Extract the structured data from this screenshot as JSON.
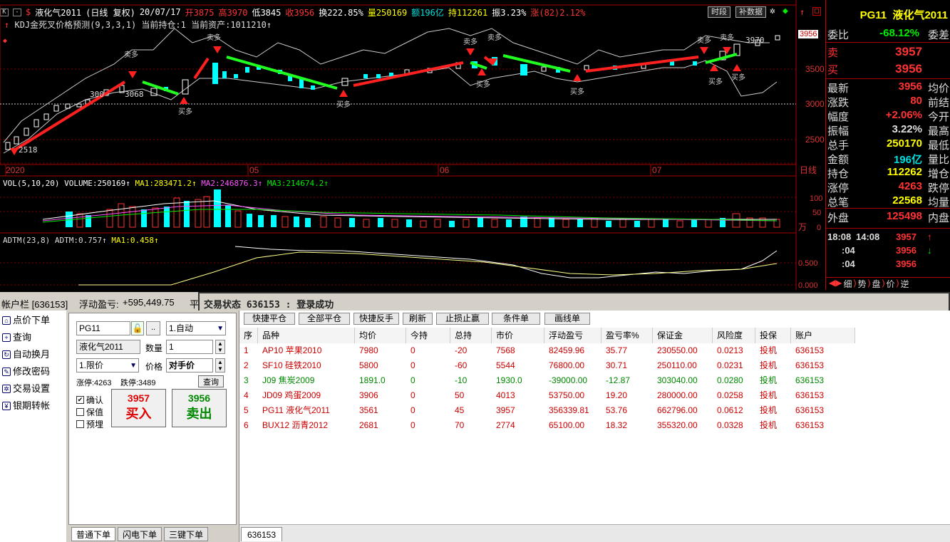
{
  "infobar": {
    "name": "液化气2011",
    "period": "(日线 复权)",
    "date": "20/07/17",
    "open": "开3875",
    "high": "高3970",
    "low": "低3845",
    "close": "收3956",
    "turnover": "换222.85%",
    "volume": "量250169",
    "amount": "额196亿",
    "hold": "持112261",
    "amplitude": "振3.23%",
    "change": "涨(82)2.12%",
    "btn_time": "时段",
    "btn_fill": "补数据"
  },
  "kdj_label": "KDJ金死叉价格预测(9,3,3,1)",
  "kdj_hold": "当前持仓:1",
  "kdj_assets": "当前资产:1011210",
  "price_labels": {
    "p3056": "3068",
    "p3000": "300",
    "p2518": "2518",
    "p3970": "3970",
    "mark": "3956"
  },
  "y_axis": [
    "3500",
    "3000",
    "2500"
  ],
  "x_axis": [
    "2020",
    "05",
    "06",
    "07",
    "日线"
  ],
  "vol_label": "VOL(5,10,20)",
  "vol_val": "VOLUME:250169",
  "vol_ma1": "MA1:283471.2",
  "vol_ma2": "MA2:246876.3",
  "vol_ma3": "MA3:214674.2",
  "vol_axis": [
    "100",
    "50",
    "0"
  ],
  "vol_unit": "万",
  "adtm_label": "ADTM(23,8)",
  "adtm_val": "ADTM:0.757",
  "adtm_ma": "MA1:0.458",
  "adtm_axis": [
    "0.500",
    "0.000"
  ],
  "buy_sell_labels": {
    "sell": "卖多",
    "buy": "买多"
  },
  "quote": {
    "code": "PG11",
    "name": "液化气2011",
    "weibi_label": "委比",
    "weibi": "-68.12%",
    "weicha_label": "委差",
    "sell_label": "卖",
    "sell": "3957",
    "buy_label": "买",
    "buy": "3956",
    "rows": [
      {
        "l": "最新",
        "v": "3956",
        "r": "均价",
        "c": "#ff3333"
      },
      {
        "l": "涨跌",
        "v": "80",
        "r": "前结",
        "c": "#ff3333"
      },
      {
        "l": "幅度",
        "v": "+2.06%",
        "r": "今开",
        "c": "#ff3333"
      },
      {
        "l": "振幅",
        "v": "3.22%",
        "r": "最高",
        "c": "#dddddd"
      },
      {
        "l": "总手",
        "v": "250170",
        "r": "最低",
        "c": "#ffff00"
      },
      {
        "l": "金额",
        "v": "196亿",
        "r": "量比",
        "c": "#00e0e0"
      },
      {
        "l": "持仓",
        "v": "112262",
        "r": "增仓",
        "c": "#ffff00"
      },
      {
        "l": "涨停",
        "v": "4263",
        "r": "跌停",
        "c": "#ff3333"
      },
      {
        "l": "总笔",
        "v": "22568",
        "r": "均量",
        "c": "#ffff00"
      }
    ],
    "waipan_label": "外盘",
    "waipan": "125498",
    "neipan_label": "内盘",
    "ticks": [
      {
        "t": "18:08",
        "t2": "14:08",
        "p": "3957",
        "a": "↑"
      },
      {
        "t": ":04",
        "t2": "",
        "p": "3956",
        "a": "↓"
      },
      {
        "t": ":04",
        "t2": "",
        "p": "3956",
        "a": ""
      }
    ],
    "tabs": [
      "细",
      "势",
      "盘",
      "价",
      "逆"
    ]
  },
  "account_bar": {
    "label": "帐户栏 [636153]",
    "profit_label": "浮动盈亏:",
    "profit": "+595,449.75",
    "flat": "平"
  },
  "status": "交易状态 636153 : 登录成功",
  "nav": [
    {
      "label": "点价下单",
      "icon": "chart-icon"
    },
    {
      "label": "查询",
      "icon": "plus-icon"
    },
    {
      "label": "自动换月",
      "icon": "cycle-icon"
    },
    {
      "label": "修改密码",
      "icon": "edit-icon"
    },
    {
      "label": "交易设置",
      "icon": "gear-icon"
    },
    {
      "label": "银期转帐",
      "icon": "money-icon"
    }
  ],
  "order": {
    "code": "PG11",
    "mode": "1.自动",
    "name": "液化气2011",
    "qty_label": "数量",
    "qty": "1",
    "type": "1.限价",
    "price_label": "价格",
    "price": "对手价",
    "limit_up": "涨停:4263",
    "limit_down": "跌停:3489",
    "query": "查询",
    "confirm": "确认",
    "hedge": "保值",
    "preorder": "预埋",
    "buy_price": "3957",
    "buy_label": "买入",
    "sell_price": "3956",
    "sell_label": "卖出",
    "dots": ".."
  },
  "table_buttons": [
    "快捷平仓",
    "全部平仓",
    "快捷反手",
    "刷新",
    "止损止赢",
    "条件单",
    "画线单"
  ],
  "table_headers": [
    "序",
    "品种",
    "均价",
    "今持",
    "总持",
    "市价",
    "浮动盈亏",
    "盈亏率%",
    "保证金",
    "风险度",
    "投保",
    "账户"
  ],
  "table_rows": [
    {
      "c": "red",
      "cells": [
        "1",
        "AP10 苹果2010",
        "7980",
        "0",
        "-20",
        "7568",
        "82459.96",
        "35.77",
        "230550.00",
        "0.0213",
        "投机",
        "636153"
      ]
    },
    {
      "c": "red",
      "cells": [
        "2",
        "SF10 硅铁2010",
        "5800",
        "0",
        "-60",
        "5544",
        "76800.00",
        "30.71",
        "250110.00",
        "0.0231",
        "投机",
        "636153"
      ]
    },
    {
      "c": "grn",
      "cells": [
        "3",
        "J09 焦炭2009",
        "1891.0",
        "0",
        "-10",
        "1930.0",
        "-39000.00",
        "-12.87",
        "303040.00",
        "0.0280",
        "投机",
        "636153"
      ]
    },
    {
      "c": "red",
      "cells": [
        "4",
        "JD09 鸡蛋2009",
        "3906",
        "0",
        "50",
        "4013",
        "53750.00",
        "19.20",
        "280000.00",
        "0.0258",
        "投机",
        "636153"
      ]
    },
    {
      "c": "red",
      "cells": [
        "5",
        "PG11 液化气2011",
        "3561",
        "0",
        "45",
        "3957",
        "356339.81",
        "53.76",
        "662796.00",
        "0.0612",
        "投机",
        "636153"
      ]
    },
    {
      "c": "red",
      "cells": [
        "6",
        "BUX12 沥青2012",
        "2681",
        "0",
        "70",
        "2774",
        "65100.00",
        "18.32",
        "355320.00",
        "0.0328",
        "投机",
        "636153"
      ]
    }
  ],
  "bottom_tabs": [
    "普通下单",
    "闪电下单",
    "三键下单"
  ],
  "account_tab": "636153"
}
